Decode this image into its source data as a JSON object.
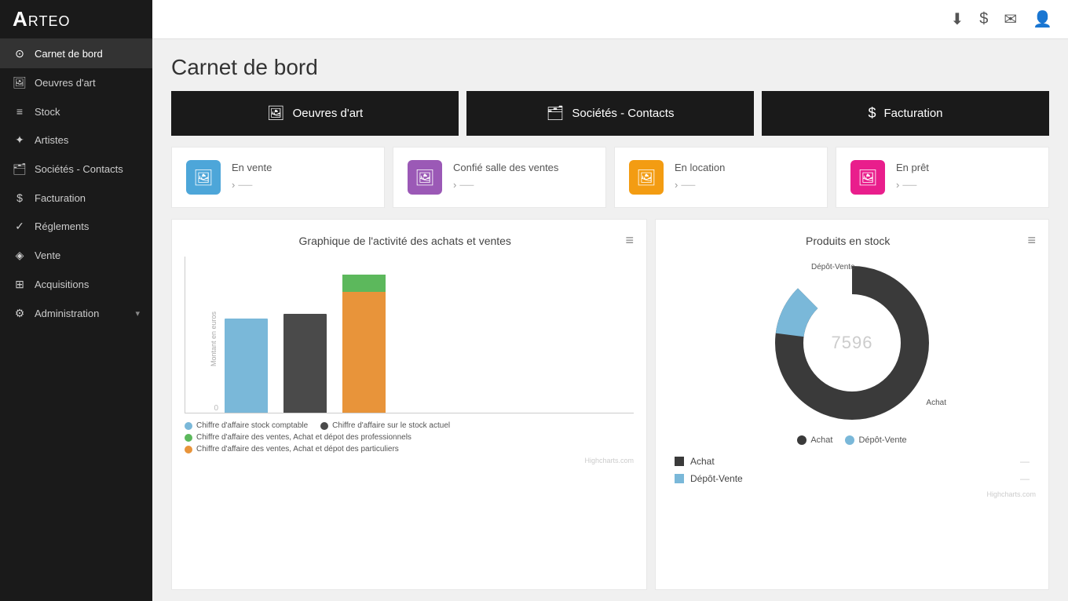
{
  "app": {
    "logo": "ARTEO"
  },
  "sidebar": {
    "items": [
      {
        "id": "carnet-de-bord",
        "label": "Carnet de bord",
        "icon": "⊙",
        "active": true
      },
      {
        "id": "oeuvres-art",
        "label": "Oeuvres d'art",
        "icon": "🖼",
        "active": false
      },
      {
        "id": "stock",
        "label": "Stock",
        "icon": "≡",
        "active": false
      },
      {
        "id": "artistes",
        "label": "Artistes",
        "icon": "✦",
        "active": false
      },
      {
        "id": "societes-contacts",
        "label": "Sociétés - Contacts",
        "icon": "🗂",
        "active": false
      },
      {
        "id": "facturation",
        "label": "Facturation",
        "icon": "$",
        "active": false
      },
      {
        "id": "reglements",
        "label": "Réglements",
        "icon": "✓",
        "active": false
      },
      {
        "id": "vente",
        "label": "Vente",
        "icon": "◈",
        "active": false
      },
      {
        "id": "acquisitions",
        "label": "Acquisitions",
        "icon": "⊞",
        "active": false
      },
      {
        "id": "administration",
        "label": "Administration",
        "icon": "⚙",
        "active": false,
        "has_arrow": true
      }
    ]
  },
  "header": {
    "title": "Carnet de bord"
  },
  "quick_actions": [
    {
      "id": "oeuvres-art-btn",
      "label": "Oeuvres d'art",
      "icon": "🖼"
    },
    {
      "id": "societes-contacts-btn",
      "label": "Sociétés - Contacts",
      "icon": "🗂"
    },
    {
      "id": "facturation-btn",
      "label": "Facturation",
      "icon": "$"
    }
  ],
  "status_cards": [
    {
      "id": "en-vente",
      "label": "En vente",
      "icon": "🖼",
      "icon_class": "icon-blue",
      "value": "›",
      "num": "—"
    },
    {
      "id": "confie-salle-ventes",
      "label": "Confié salle des ventes",
      "icon": "🖼",
      "icon_class": "icon-purple",
      "value": "›",
      "num": "—"
    },
    {
      "id": "en-location",
      "label": "En location",
      "icon": "🖼",
      "icon_class": "icon-orange",
      "value": "›",
      "num": "—"
    },
    {
      "id": "en-pret",
      "label": "En prêt",
      "icon": "🖼",
      "icon_class": "icon-pink",
      "value": "›",
      "num": "—"
    }
  ],
  "bar_chart": {
    "title": "Graphique de l'activité des achats et ventes",
    "y_axis_title": "Montant en euros",
    "y_labels": [
      "",
      "",
      "",
      "",
      "0"
    ],
    "bars": [
      {
        "id": "bar-1",
        "color": "blue",
        "height_pct": 60,
        "label": ""
      },
      {
        "id": "bar-2",
        "color": "dark",
        "height_pct": 63,
        "label": ""
      },
      {
        "id": "bar-3",
        "color": "orange-green",
        "height_pct": 88,
        "label": ""
      }
    ],
    "legend": [
      {
        "color": "#7ab8d9",
        "type": "dot",
        "text": "Chiffre d'affaire stock comptable"
      },
      {
        "color": "#4a4a4a",
        "type": "dot",
        "text": "Chiffre d'affaire sur le stock actuel"
      },
      {
        "color": "#5cb85c",
        "type": "dot",
        "text": "Chiffre d'affaire des ventes, Achat et dépot des professionnels"
      },
      {
        "color": "#e8943a",
        "type": "dot",
        "text": "Chiffre d'affaire des ventes, Achat et dépot des particuliers"
      }
    ],
    "credit": "Highcharts.com"
  },
  "donut_chart": {
    "title": "Produits en stock",
    "center_text": "7596",
    "label_depot": "Dépôt-Vente",
    "label_achat": "Achat",
    "legend": [
      {
        "color": "#3a3a3a",
        "label": "Achat"
      },
      {
        "color": "#7ab8d9",
        "label": "Dépôt-Vente"
      }
    ],
    "table": [
      {
        "color": "sq-dark",
        "name": "Achat",
        "value": "—"
      },
      {
        "color": "sq-blue",
        "name": "Dépôt-Vente",
        "value": "—"
      }
    ],
    "credit": "Highcharts.com"
  },
  "topbar_icons": {
    "download": "⬇",
    "dollar": "$",
    "mail": "✉",
    "user": "👤"
  }
}
